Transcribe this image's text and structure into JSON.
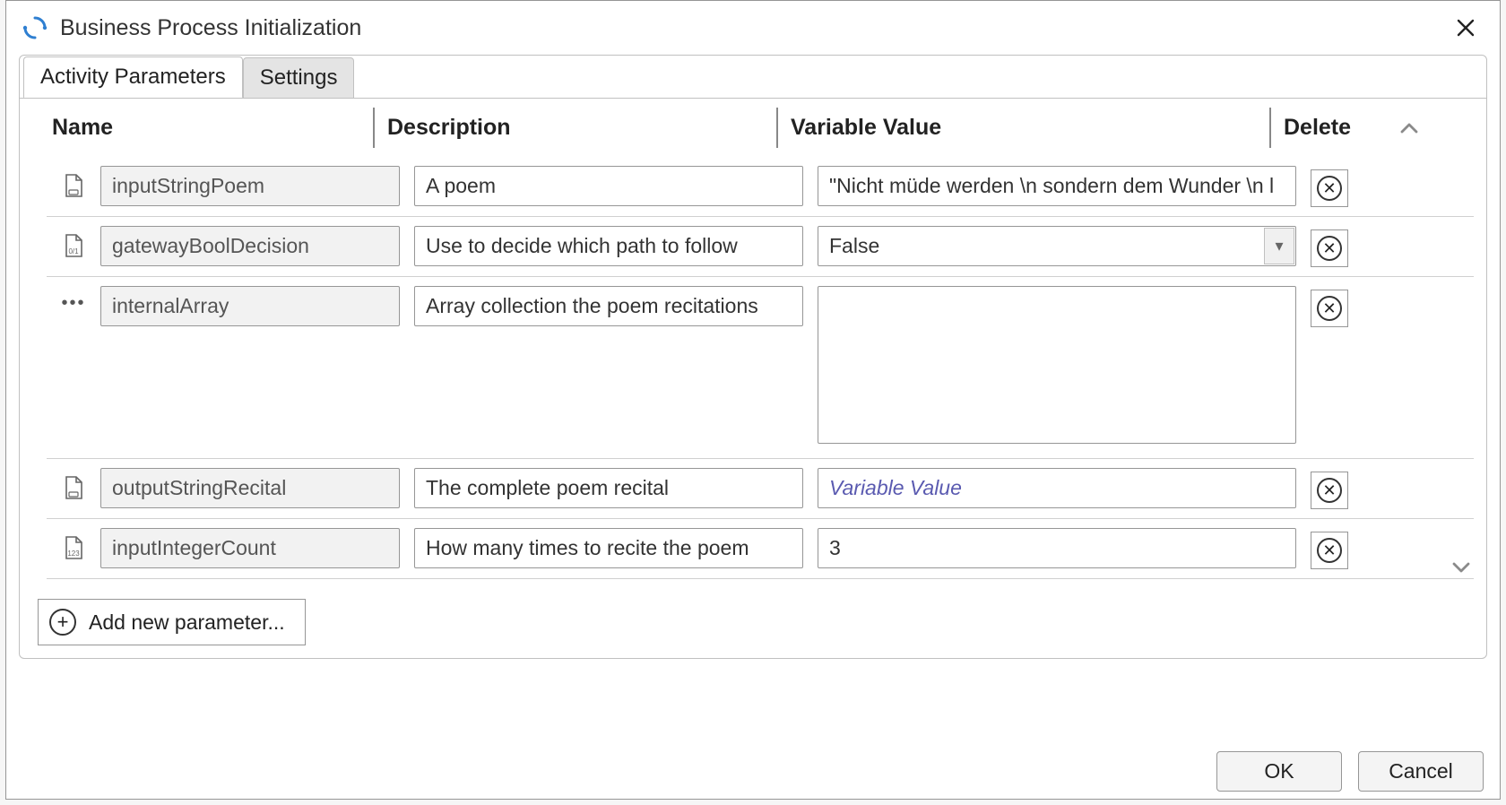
{
  "window": {
    "title": "Business Process Initialization"
  },
  "tabs": {
    "activity_parameters": "Activity Parameters",
    "settings": "Settings"
  },
  "headers": {
    "name": "Name",
    "description": "Description",
    "variable_value": "Variable Value",
    "delete": "Delete"
  },
  "rows": [
    {
      "icon": "file-text-icon",
      "name": "inputStringPoem",
      "description": "A poem",
      "value_type": "text",
      "value": "\"Nicht müde werden \\n sondern dem Wunder \\n l"
    },
    {
      "icon": "file-bool-icon",
      "name": "gatewayBoolDecision",
      "description": "Use to decide which path to follow",
      "value_type": "select",
      "value": "False"
    },
    {
      "icon": "ellipsis-icon",
      "name": "internalArray",
      "description": "Array collection the poem recitations",
      "value_type": "textarea",
      "value": ""
    },
    {
      "icon": "file-text-icon",
      "name": "outputStringRecital",
      "description": "The complete poem recital",
      "value_type": "text-placeholder",
      "value": "Variable Value"
    },
    {
      "icon": "file-number-icon",
      "name": "inputIntegerCount",
      "description": "How many times to recite the poem",
      "value_type": "text",
      "value": "3"
    }
  ],
  "buttons": {
    "add_parameter": "Add new parameter...",
    "ok": "OK",
    "cancel": "Cancel"
  }
}
